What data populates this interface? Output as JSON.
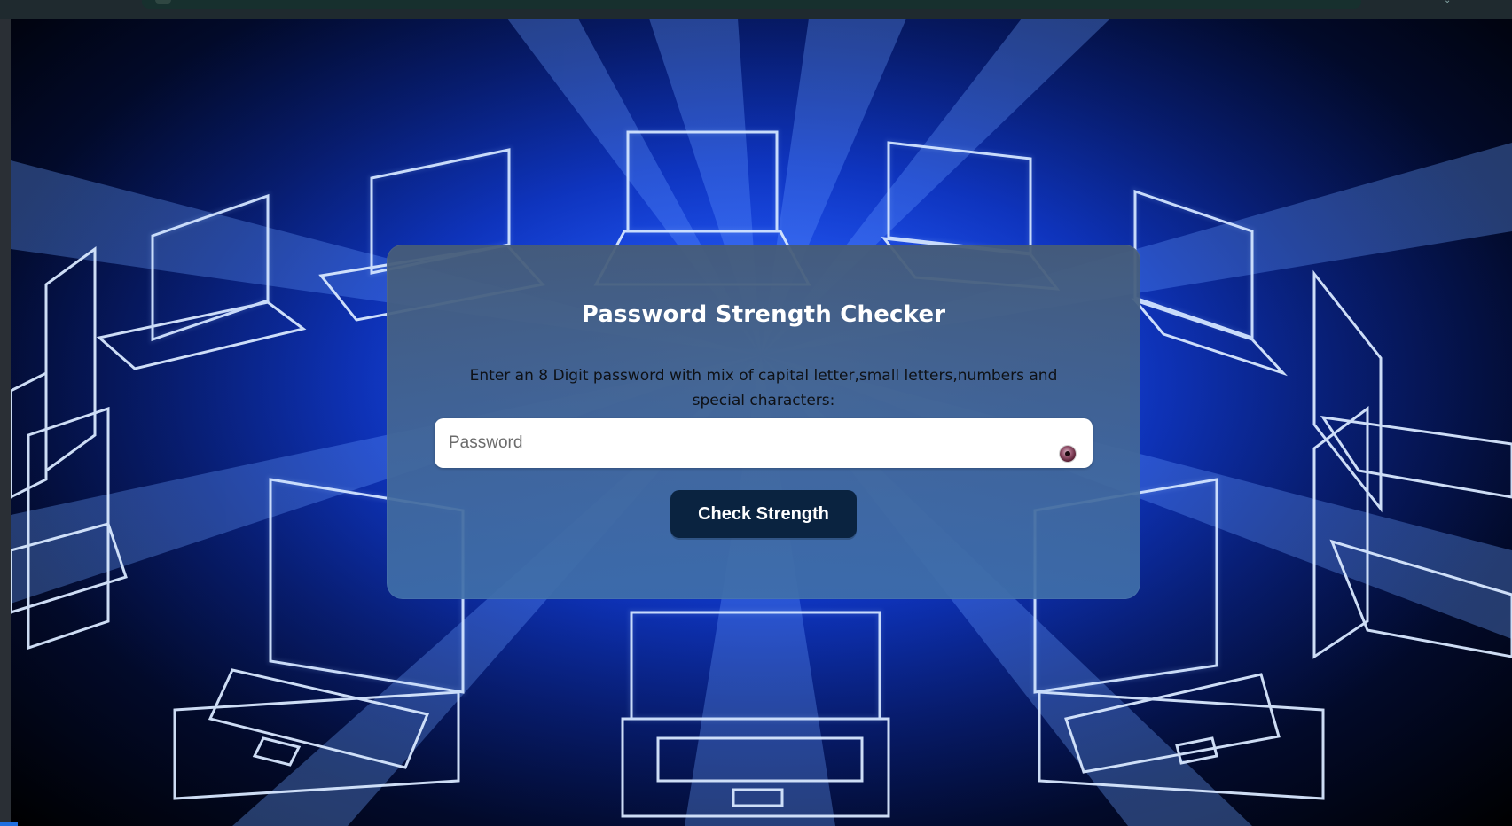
{
  "page": {
    "title": "Password Strength Checker",
    "instructions": "Enter an 8 Digit password with mix of capital letter,small letters,numbers and special characters:"
  },
  "form": {
    "password_placeholder": "Password",
    "password_value": "",
    "eye_icon": "eye-icon",
    "check_button_label": "Check Strength"
  },
  "colors": {
    "card_bg": "#4a6b93",
    "button_bg": "#0a2340",
    "background_accent": "#0d3ee0"
  }
}
